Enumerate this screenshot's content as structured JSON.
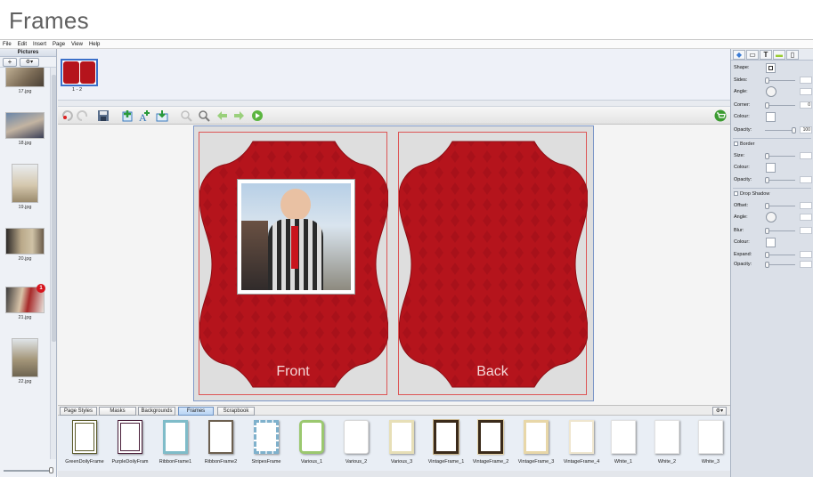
{
  "heading": "Frames",
  "menu": [
    "File",
    "Edit",
    "Insert",
    "Page",
    "View",
    "Help"
  ],
  "pictures_panel": {
    "title": "Pictures",
    "add_label": "+",
    "settings_label": "⚙▾",
    "thumbnails": [
      {
        "name": "17.jpg",
        "badge": null
      },
      {
        "name": "18.jpg",
        "badge": null
      },
      {
        "name": "19.jpg",
        "badge": null
      },
      {
        "name": "20.jpg",
        "badge": null
      },
      {
        "name": "21.jpg",
        "badge": "1"
      },
      {
        "name": "22.jpg",
        "badge": null
      }
    ]
  },
  "pages_strip": {
    "spread_label": "1 - 2"
  },
  "spread": {
    "front_label": "Front",
    "back_label": "Back",
    "frame_color": "#b5141c"
  },
  "tabs": [
    "Page Styles",
    "Masks",
    "Backgrounds",
    "Frames",
    "Scrapbook"
  ],
  "active_tab": "Frames",
  "frames": [
    {
      "name": "GreenDoilyFrame",
      "color": "#5b5a2a"
    },
    {
      "name": "PurpleDoilyFram",
      "color": "#4a1f3a"
    },
    {
      "name": "RibbonFrame1",
      "color": "#7fbcc9"
    },
    {
      "name": "RibbonFrame2",
      "color": "#6d6050"
    },
    {
      "name": "StripesFrame",
      "color": "#7fb1cc"
    },
    {
      "name": "Various_1",
      "color": "#9bc86f"
    },
    {
      "name": "Various_2",
      "color": "#d9d9d9"
    },
    {
      "name": "Various_3",
      "color": "#e7dfb7"
    },
    {
      "name": "VintageFrame_1",
      "color": "#3a2a1a"
    },
    {
      "name": "VintageFrame_2",
      "color": "#3a2a1a"
    },
    {
      "name": "VintageFrame_3",
      "color": "#e8d7a8"
    },
    {
      "name": "VintageFrame_4",
      "color": "#efe6cf"
    },
    {
      "name": "White_1",
      "color": "#e2e2e2"
    },
    {
      "name": "White_2",
      "color": "#e2e2e2"
    },
    {
      "name": "White_3",
      "color": "#e2e2e2"
    }
  ],
  "properties": {
    "shape_label": "Shape:",
    "sides_label": "Sides:",
    "angle_label": "Angle:",
    "corner_label": "Corner:",
    "corner_value": "0",
    "colour_label": "Colour:",
    "opacity_label": "Opacity:",
    "opacity_value": "100",
    "border_label": "Border",
    "size_label": "Size:",
    "drop_shadow_label": "Drop Shadow",
    "offset_label": "Offset:",
    "blur_label": "Blur:",
    "expand_label": "Expand:"
  }
}
